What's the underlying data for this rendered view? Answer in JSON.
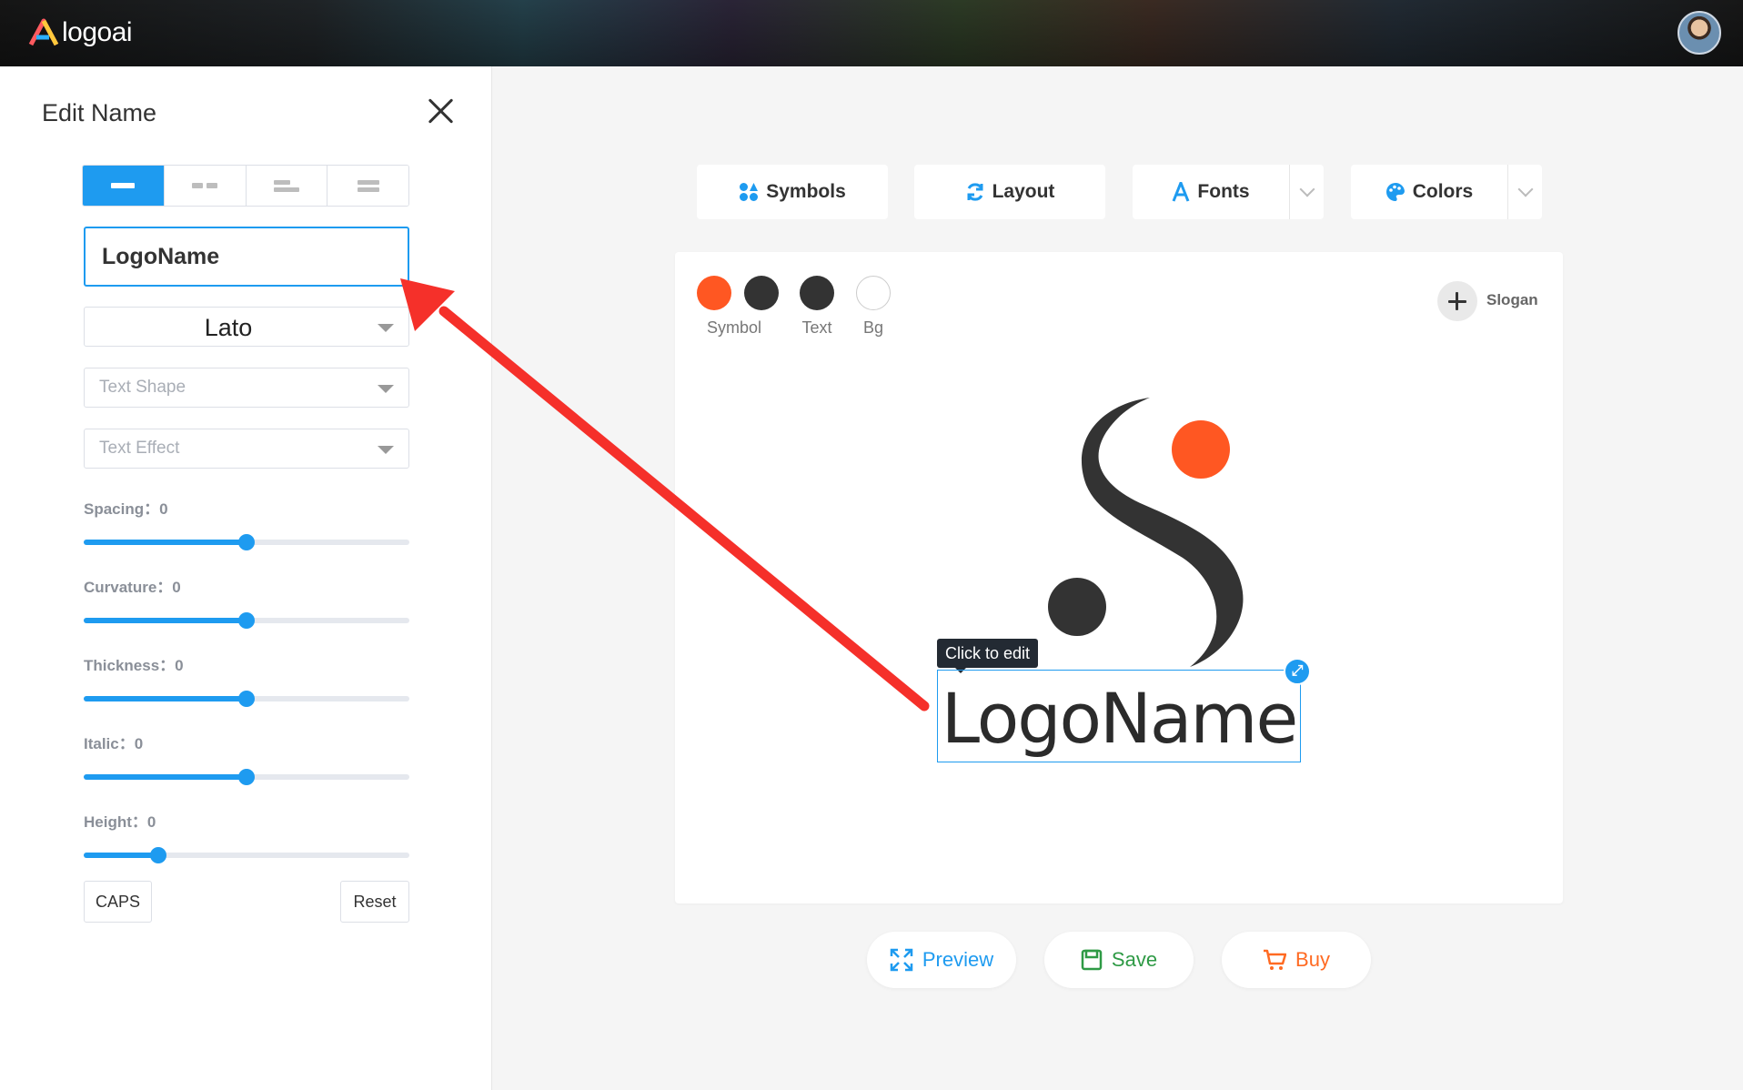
{
  "header": {
    "brand": "logoai",
    "accent_colors": [
      "#ff5a5f",
      "#2bb0ff",
      "#ffc93c"
    ]
  },
  "panel": {
    "title": "Edit Name",
    "layout_options": [
      {
        "name": "single-line",
        "active": true
      },
      {
        "name": "two-words",
        "active": false
      },
      {
        "name": "left-aligned",
        "active": false
      },
      {
        "name": "stacked",
        "active": false
      }
    ],
    "name_value": "LogoName",
    "font_value": "Lato",
    "text_shape_placeholder": "Text Shape",
    "text_effect_placeholder": "Text Effect",
    "sliders": [
      {
        "label": "Spacing：0",
        "level": 0.5
      },
      {
        "label": "Curvature：0",
        "level": 0.5
      },
      {
        "label": "Thickness：0",
        "level": 0.5
      },
      {
        "label": "Italic：0",
        "level": 0.5
      },
      {
        "label": "Height：0",
        "level": 0.23
      }
    ],
    "caps_label": "CAPS",
    "reset_label": "Reset"
  },
  "toolbar": {
    "symbols": "Symbols",
    "layout": "Layout",
    "fonts": "Fonts",
    "colors": "Colors",
    "accent": "#1e9bf0"
  },
  "canvas": {
    "swatches": [
      {
        "label": "Symbol",
        "color": "#ff5722"
      },
      {
        "label": "Text",
        "color": "#333333"
      },
      {
        "label": "",
        "color": "#333333"
      },
      {
        "label": "Bg",
        "color": "#ffffff"
      }
    ],
    "slogan_label": "Slogan",
    "tooltip": "Click to edit",
    "logo_name": "LogoName",
    "symbol_colors": {
      "shape": "#333333",
      "dot": "#ff5722"
    }
  },
  "actions": {
    "preview": "Preview",
    "save": "Save",
    "buy": "Buy",
    "preview_color": "#1e9bf0",
    "save_color": "#2e9a45",
    "buy_color": "#ff6a22"
  },
  "annotation": {
    "arrow_color": "#f5302a"
  }
}
